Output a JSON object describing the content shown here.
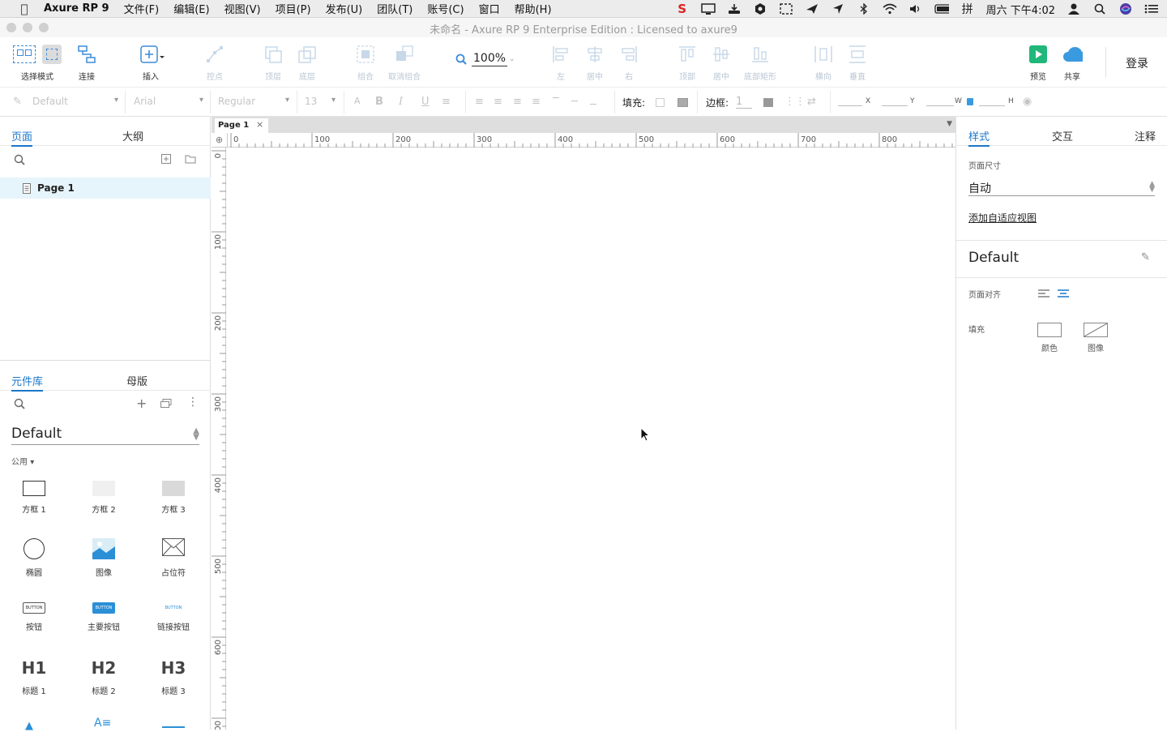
{
  "menubar": {
    "app_name": "Axure RP 9",
    "menus": [
      "文件(F)",
      "编辑(E)",
      "视图(V)",
      "项目(P)",
      "发布(U)",
      "团队(T)",
      "账号(C)",
      "窗口",
      "帮助(H)"
    ],
    "clock": "周六 下午4:02",
    "input_method": "拼"
  },
  "window": {
    "title": "未命名 - Axure RP 9 Enterprise Edition : Licensed to axure9"
  },
  "toolbar": {
    "select_mode": "选择模式",
    "connect": "连接",
    "insert": "插入",
    "points": "控点",
    "top_layer": "顶层",
    "bottom_layer": "底层",
    "group": "组合",
    "ungroup": "取消组合",
    "zoom": "100%",
    "align_left": "左",
    "align_center": "居中",
    "align_right": "右",
    "align_top": "顶部",
    "align_middle": "居中",
    "align_bottom": "底部矩形",
    "distribute_h": "横向",
    "distribute_v": "垂直",
    "preview": "预览",
    "share": "共享",
    "login": "登录"
  },
  "formatbar": {
    "style": "Default",
    "font": "Arial",
    "weight": "Regular",
    "size": "13",
    "fill_label": "填充:",
    "border_label": "边框:",
    "border_value": "1",
    "x_label": "X",
    "y_label": "Y",
    "w_label": "W",
    "h_label": "H"
  },
  "left_panel": {
    "tabs": [
      "页面",
      "大纲"
    ],
    "pages": [
      "Page 1"
    ],
    "lib_tabs": [
      "元件库",
      "母版"
    ],
    "library": "Default",
    "category": "公用",
    "widgets": [
      [
        "方框 1",
        "方框 2",
        "方框 3"
      ],
      [
        "椭圆",
        "图像",
        "占位符"
      ],
      [
        "按钮",
        "主要按钮",
        "链接按钮"
      ],
      [
        "标题 1",
        "标题 2",
        "标题 3"
      ]
    ],
    "button_text": "BUTTON",
    "headings": [
      "H1",
      "H2",
      "H3"
    ]
  },
  "canvas": {
    "tab": "Page 1",
    "h_ticks": [
      "0",
      "100",
      "200",
      "300",
      "400",
      "500",
      "600",
      "700",
      "800"
    ],
    "v_ticks": [
      "0",
      "100",
      "200",
      "300",
      "400",
      "500",
      "600",
      "700"
    ]
  },
  "right_panel": {
    "tabs": [
      "样式",
      "交互",
      "注释"
    ],
    "page_size_label": "页面尺寸",
    "page_size_value": "自动",
    "add_adaptive": "添加自适应视图",
    "style_name": "Default",
    "page_align_label": "页面对齐",
    "fill_label": "填充",
    "fill_color": "颜色",
    "fill_image": "图像"
  },
  "colors": {
    "accent": "#1a77c9",
    "preview_green": "#1fb87a",
    "share_blue": "#3a9ae0"
  }
}
